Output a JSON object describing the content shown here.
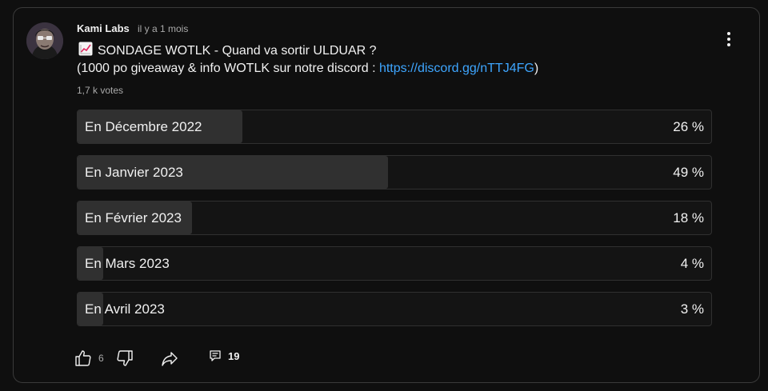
{
  "post": {
    "author": "Kami Labs",
    "time": "il y a 1 mois",
    "title": "SONDAGE WOTLK - Quand va sortir ULDUAR ?",
    "line2_prefix": "(1000 po giveaway & info WOTLK sur notre discord : ",
    "link_text": "https://discord.gg/nTTJ4FG",
    "line2_suffix": ")",
    "votes": "1,7 k votes"
  },
  "poll": {
    "options": [
      {
        "label": "En Décembre 2022",
        "percent_text": "26 %",
        "percent": 26
      },
      {
        "label": "En Janvier 2023",
        "percent_text": "49 %",
        "percent": 49
      },
      {
        "label": "En Février 2023",
        "percent_text": "18 %",
        "percent": 18
      },
      {
        "label": "En Mars 2023",
        "percent_text": "4 %",
        "percent": 4
      },
      {
        "label": "En Avril 2023",
        "percent_text": "3 %",
        "percent": 3
      }
    ]
  },
  "actions": {
    "likes": "6",
    "comments": "19"
  },
  "icons": {
    "title_icon": "chart-increasing-icon",
    "like": "thumbs-up-icon",
    "dislike": "thumbs-down-icon",
    "share": "share-icon",
    "comments": "comment-icon",
    "menu": "more-vertical-icon"
  },
  "colors": {
    "background": "#0f0f0f",
    "link": "#3ea6ff",
    "bar_fill": "#303030"
  }
}
